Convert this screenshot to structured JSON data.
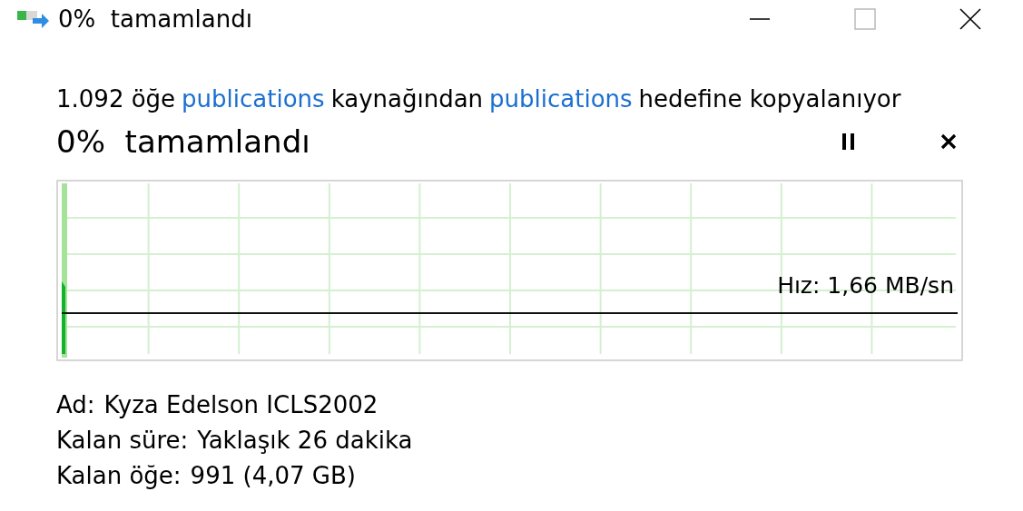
{
  "window": {
    "title": "0%  tamamlandı"
  },
  "description": {
    "count": "1.092 öğe",
    "source": "publications",
    "source_suffix": "kaynağından",
    "target": "publications",
    "target_suffix": "hedefine kopyalanıyor"
  },
  "progress": {
    "label": "0%  tamamlandı",
    "level": 0,
    "speed": "Hız: 1,66 MB/sn"
  },
  "details": [
    {
      "label": "Ad:",
      "value": "Kyza Edelson ICLS2002"
    },
    {
      "label": "Kalan süre:",
      "value": "Yaklaşık 26 dakika"
    },
    {
      "label": "Kalan öğe:",
      "value": "991 (4,07 GB)"
    }
  ]
}
